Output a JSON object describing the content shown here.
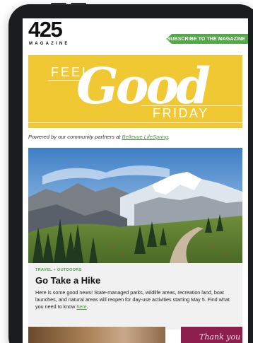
{
  "masthead": {
    "logo_number": "425",
    "logo_word": "MAGAZINE",
    "subscribe_label": "SUBSCRIBE TO THE MAGAZINE"
  },
  "banner": {
    "feel": "FEEL",
    "good": "Good",
    "friday": "FRIDAY",
    "background_color": "#f0c834"
  },
  "powered": {
    "prefix": "Powered by our community partners at ",
    "partner_link": "Bellevue LifeSpring",
    "suffix": "."
  },
  "article": {
    "category": "TRAVEL + OUTDOORS",
    "title": "Go Take a Hike",
    "body": "Here is some good news! State-managed parks, wildlife areas, recreation land, boat launches, and natural areas will reopen for day-use activities starting May 5. Find what you need to know ",
    "link": "here",
    "body_end": "."
  },
  "next_teaser": {
    "script_text": "Thank you"
  },
  "colors": {
    "accent_green": "#55a84a",
    "device_frame": "#1b1c1e"
  }
}
